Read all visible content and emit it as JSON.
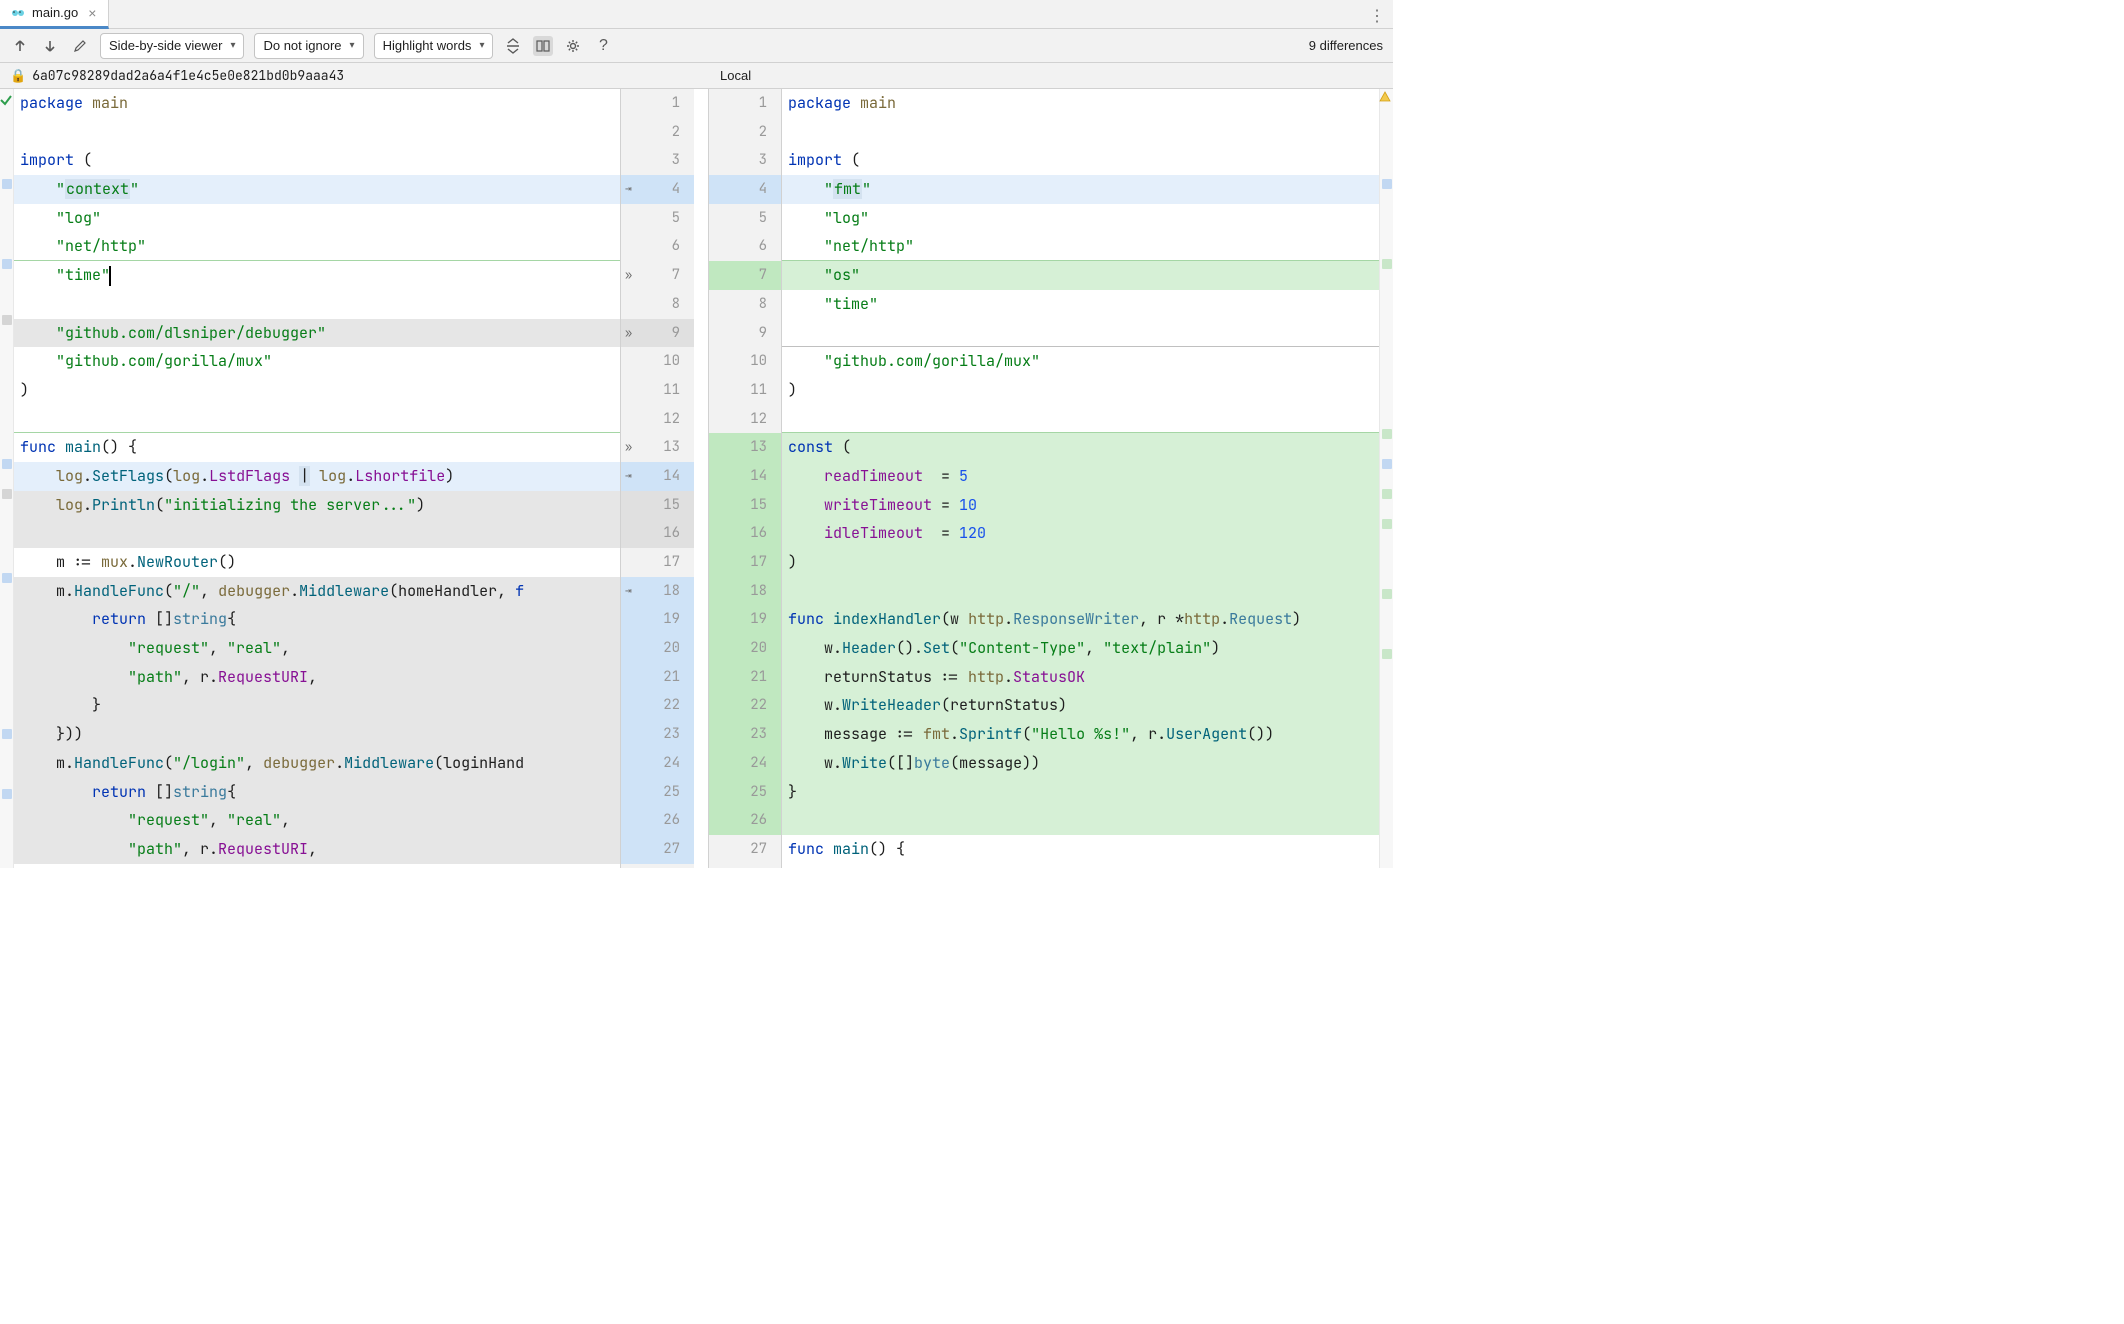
{
  "tab": {
    "filename": "main.go"
  },
  "toolbar": {
    "viewer_mode": "Side-by-side viewer",
    "ignore_mode": "Do not ignore",
    "highlight_mode": "Highlight words",
    "diff_count": "9 differences"
  },
  "revision": {
    "hash": "6a07c98289dad2a6a4f1e4c5e0e821bd0b9aaa43",
    "local_label": "Local"
  },
  "left_lines": [
    {
      "n": 1,
      "class": "",
      "html": "<span class='tok-kw'>package</span> <span class='tok-pkg'>main</span>"
    },
    {
      "n": 2,
      "class": "",
      "html": ""
    },
    {
      "n": 3,
      "class": "",
      "html": "<span class='tok-kw'>import</span> ("
    },
    {
      "n": 4,
      "class": "bg-blue",
      "html": "    <span class='tok-str'>\"<span class='hl-box'>context</span>\"</span>"
    },
    {
      "n": 5,
      "class": "",
      "html": "    <span class='tok-str'>\"log\"</span>"
    },
    {
      "n": 6,
      "class": "border-green-bot",
      "html": "    <span class='tok-str'>\"net/http\"</span>"
    },
    {
      "n": 7,
      "class": "",
      "html": "    <span class='tok-str'>\"time\"</span><span class='cursor'></span>"
    },
    {
      "n": 8,
      "class": "",
      "html": ""
    },
    {
      "n": 9,
      "class": "bg-gray",
      "html": "    <span class='tok-str'>\"github.com/dlsniper/debugger\"</span>"
    },
    {
      "n": 10,
      "class": "",
      "html": "    <span class='tok-str'>\"github.com/gorilla/mux\"</span>"
    },
    {
      "n": 11,
      "class": "",
      "html": ")"
    },
    {
      "n": 12,
      "class": "border-green-bot",
      "html": ""
    },
    {
      "n": 13,
      "class": "",
      "html": "<span class='tok-kw'>func</span> <span class='tok-fn'>main</span>() {"
    },
    {
      "n": 14,
      "class": "bg-blue",
      "html": "    <span class='tok-pkg'>log</span>.<span class='tok-fn'>SetFlags</span>(<span class='tok-pkg'>log</span>.<span class='tok-ident'>LstdFlags</span> <span class='hl-box'>|</span> <span class='tok-pkg'>log</span>.<span class='tok-ident'>Lshortfile</span>)"
    },
    {
      "n": 15,
      "class": "bg-gray",
      "html": "    <span class='tok-pkg'>log</span>.<span class='tok-fn'>Println</span>(<span class='tok-str'>\"initializing the server...\"</span>)"
    },
    {
      "n": 16,
      "class": "bg-gray",
      "html": ""
    },
    {
      "n": 17,
      "class": "",
      "html": "    m := <span class='tok-pkg'>mux</span>.<span class='tok-fn'>NewRouter</span>()"
    },
    {
      "n": 18,
      "class": "bg-gray",
      "html": "    m.<span class='tok-fn'>HandleFunc</span>(<span class='tok-str'>\"/\"</span>, <span class='tok-pkg'>debugger</span>.<span class='tok-fn'>Middleware</span>(homeHandler, <span class='tok-kw'>f</span>"
    },
    {
      "n": 19,
      "class": "bg-gray",
      "html": "        <span class='tok-kw'>return</span> []<span class='tok-typ'>string</span>{"
    },
    {
      "n": 20,
      "class": "bg-gray",
      "html": "            <span class='tok-str'>\"request\"</span>, <span class='tok-str'>\"real\"</span>,"
    },
    {
      "n": 21,
      "class": "bg-gray",
      "html": "            <span class='tok-str'>\"path\"</span>, r.<span class='tok-field'>RequestURI</span>,"
    },
    {
      "n": 22,
      "class": "bg-gray",
      "html": "        }"
    },
    {
      "n": 23,
      "class": "bg-gray",
      "html": "    }))"
    },
    {
      "n": 24,
      "class": "bg-gray",
      "html": "    m.<span class='tok-fn'>HandleFunc</span>(<span class='tok-str'>\"/login\"</span>, <span class='tok-pkg'>debugger</span>.<span class='tok-fn'>Middleware</span>(loginHand"
    },
    {
      "n": 25,
      "class": "bg-gray",
      "html": "        <span class='tok-kw'>return</span> []<span class='tok-typ'>string</span>{"
    },
    {
      "n": 26,
      "class": "bg-gray",
      "html": "            <span class='tok-str'>\"request\"</span>, <span class='tok-str'>\"real\"</span>,"
    },
    {
      "n": 27,
      "class": "bg-gray",
      "html": "            <span class='tok-str'>\"path\"</span>, r.<span class='tok-field'>RequestURI</span>,"
    }
  ],
  "right_lines": [
    {
      "n": 1,
      "class": "",
      "html": "<span class='tok-kw'>package</span> <span class='tok-pkg'>main</span>"
    },
    {
      "n": 2,
      "class": "",
      "html": ""
    },
    {
      "n": 3,
      "class": "",
      "html": "<span class='tok-kw'>import</span> ("
    },
    {
      "n": 4,
      "class": "bg-blue",
      "html": "    <span class='tok-str'>\"<span class='hl-box'>fmt</span>\"</span>"
    },
    {
      "n": 5,
      "class": "",
      "html": "    <span class='tok-str'>\"log\"</span>"
    },
    {
      "n": 6,
      "class": "border-green-bot",
      "html": "    <span class='tok-str'>\"net/http\"</span>"
    },
    {
      "n": 7,
      "class": "bg-green",
      "html": "    <span class='tok-str'>\"os\"</span>"
    },
    {
      "n": 8,
      "class": "",
      "html": "    <span class='tok-str'>\"time\"</span>"
    },
    {
      "n": 9,
      "class": "border-gray-bot",
      "html": ""
    },
    {
      "n": 10,
      "class": "",
      "html": "    <span class='tok-str'>\"github.com/gorilla/mux\"</span>"
    },
    {
      "n": 11,
      "class": "",
      "html": ")"
    },
    {
      "n": 12,
      "class": "border-green-bot",
      "html": ""
    },
    {
      "n": 13,
      "class": "bg-green",
      "html": "<span class='tok-kw'>const</span> ("
    },
    {
      "n": 14,
      "class": "bg-green",
      "html": "    <span class='tok-ident'>readTimeout</span>  = <span class='tok-num'>5</span>"
    },
    {
      "n": 15,
      "class": "bg-green",
      "html": "    <span class='tok-ident'>writeTimeout</span> = <span class='tok-num'>10</span>"
    },
    {
      "n": 16,
      "class": "bg-green",
      "html": "    <span class='tok-ident'>idleTimeout</span>  = <span class='tok-num'>120</span>"
    },
    {
      "n": 17,
      "class": "bg-green",
      "html": ")"
    },
    {
      "n": 18,
      "class": "bg-green",
      "html": ""
    },
    {
      "n": 19,
      "class": "bg-green",
      "html": "<span class='tok-kw'>func</span> <span class='tok-fn'>indexHandler</span>(w <span class='tok-pkg'>http</span>.<span class='tok-typ'>ResponseWriter</span>, r *<span class='tok-pkg'>http</span>.<span class='tok-typ'>Request</span>)"
    },
    {
      "n": 20,
      "class": "bg-green",
      "html": "    w.<span class='tok-fn'>Header</span>().<span class='tok-fn'>Set</span>(<span class='tok-str'>\"Content-Type\"</span>, <span class='tok-str'>\"text/plain\"</span>)"
    },
    {
      "n": 21,
      "class": "bg-green",
      "html": "    returnStatus := <span class='tok-pkg'>http</span>.<span class='tok-ident'>StatusOK</span>"
    },
    {
      "n": 22,
      "class": "bg-green",
      "html": "    w.<span class='tok-fn'>WriteHeader</span>(returnStatus)"
    },
    {
      "n": 23,
      "class": "bg-green",
      "html": "    message := <span class='tok-pkg'>fmt</span>.<span class='tok-fn'>Sprintf</span>(<span class='tok-str'>\"Hello %s!\"</span>, r.<span class='tok-fn'>UserAgent</span>())"
    },
    {
      "n": 24,
      "class": "bg-green",
      "html": "    w.<span class='tok-fn'>Write</span>([]<span class='tok-typ'>byte</span>(message))"
    },
    {
      "n": 25,
      "class": "bg-green",
      "html": "}"
    },
    {
      "n": 26,
      "class": "bg-green",
      "html": ""
    },
    {
      "n": 27,
      "class": "",
      "html": "<span class='tok-kw'>func</span> <span class='tok-fn'>main</span>() {"
    }
  ],
  "gutter_left": [
    {
      "n": "1",
      "cls": ""
    },
    {
      "n": "2",
      "cls": ""
    },
    {
      "n": "3",
      "cls": ""
    },
    {
      "n": "4",
      "cls": "g-blue",
      "arrow": true
    },
    {
      "n": "5",
      "cls": ""
    },
    {
      "n": "6",
      "cls": ""
    },
    {
      "n": "7",
      "cls": "",
      "chev": true
    },
    {
      "n": "8",
      "cls": ""
    },
    {
      "n": "9",
      "cls": "g-gray",
      "chev": true
    },
    {
      "n": "10",
      "cls": ""
    },
    {
      "n": "11",
      "cls": ""
    },
    {
      "n": "12",
      "cls": ""
    },
    {
      "n": "13",
      "cls": "",
      "chev": true
    },
    {
      "n": "14",
      "cls": "g-blue",
      "arrow": true
    },
    {
      "n": "15",
      "cls": "g-gray"
    },
    {
      "n": "16",
      "cls": "g-gray"
    },
    {
      "n": "17",
      "cls": ""
    },
    {
      "n": "18",
      "cls": "g-blue",
      "arrow": true
    },
    {
      "n": "19",
      "cls": "g-blue"
    },
    {
      "n": "20",
      "cls": "g-blue"
    },
    {
      "n": "21",
      "cls": "g-blue"
    },
    {
      "n": "22",
      "cls": "g-blue"
    },
    {
      "n": "23",
      "cls": "g-blue"
    },
    {
      "n": "24",
      "cls": "g-blue"
    },
    {
      "n": "25",
      "cls": "g-blue"
    },
    {
      "n": "26",
      "cls": "g-blue"
    },
    {
      "n": "27",
      "cls": "g-blue"
    }
  ],
  "gutter_right": [
    {
      "n": "1",
      "cls": ""
    },
    {
      "n": "2",
      "cls": ""
    },
    {
      "n": "3",
      "cls": ""
    },
    {
      "n": "4",
      "cls": "g-blue"
    },
    {
      "n": "5",
      "cls": ""
    },
    {
      "n": "6",
      "cls": ""
    },
    {
      "n": "7",
      "cls": "g-green"
    },
    {
      "n": "8",
      "cls": ""
    },
    {
      "n": "9",
      "cls": ""
    },
    {
      "n": "10",
      "cls": ""
    },
    {
      "n": "11",
      "cls": ""
    },
    {
      "n": "12",
      "cls": ""
    },
    {
      "n": "13",
      "cls": "g-green"
    },
    {
      "n": "14",
      "cls": "g-green"
    },
    {
      "n": "15",
      "cls": "g-green"
    },
    {
      "n": "16",
      "cls": "g-green"
    },
    {
      "n": "17",
      "cls": "g-green"
    },
    {
      "n": "18",
      "cls": "g-green"
    },
    {
      "n": "19",
      "cls": "g-green"
    },
    {
      "n": "20",
      "cls": "g-green"
    },
    {
      "n": "21",
      "cls": "g-green"
    },
    {
      "n": "22",
      "cls": "g-green"
    },
    {
      "n": "23",
      "cls": "g-green"
    },
    {
      "n": "24",
      "cls": "g-green"
    },
    {
      "n": "25",
      "cls": "g-green"
    },
    {
      "n": "26",
      "cls": "g-green"
    },
    {
      "n": "27",
      "cls": ""
    }
  ]
}
